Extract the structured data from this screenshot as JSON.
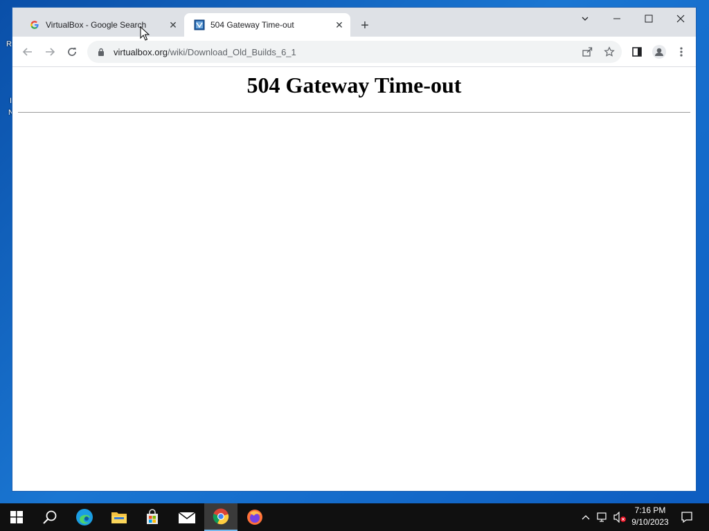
{
  "desktop": {
    "chars": [
      "R",
      "I",
      "N"
    ]
  },
  "browser": {
    "tabs": [
      {
        "title": "VirtualBox - Google Search",
        "active": false,
        "favicon": "google-g-icon"
      },
      {
        "title": "504 Gateway Time-out",
        "active": true,
        "favicon": "virtualbox-icon"
      }
    ],
    "new_tab_label": "+",
    "url_host": "virtualbox.org",
    "url_path": "/wiki/Download_Old_Builds_6_1"
  },
  "page": {
    "heading": "504 Gateway Time-out"
  },
  "taskbar": {
    "time": "7:16 PM",
    "date": "9/10/2023"
  },
  "colors": {
    "desktop": "#1565c0",
    "tabstrip": "#dee1e6",
    "taskbar": "#101010",
    "accent": "#76b9ed"
  }
}
